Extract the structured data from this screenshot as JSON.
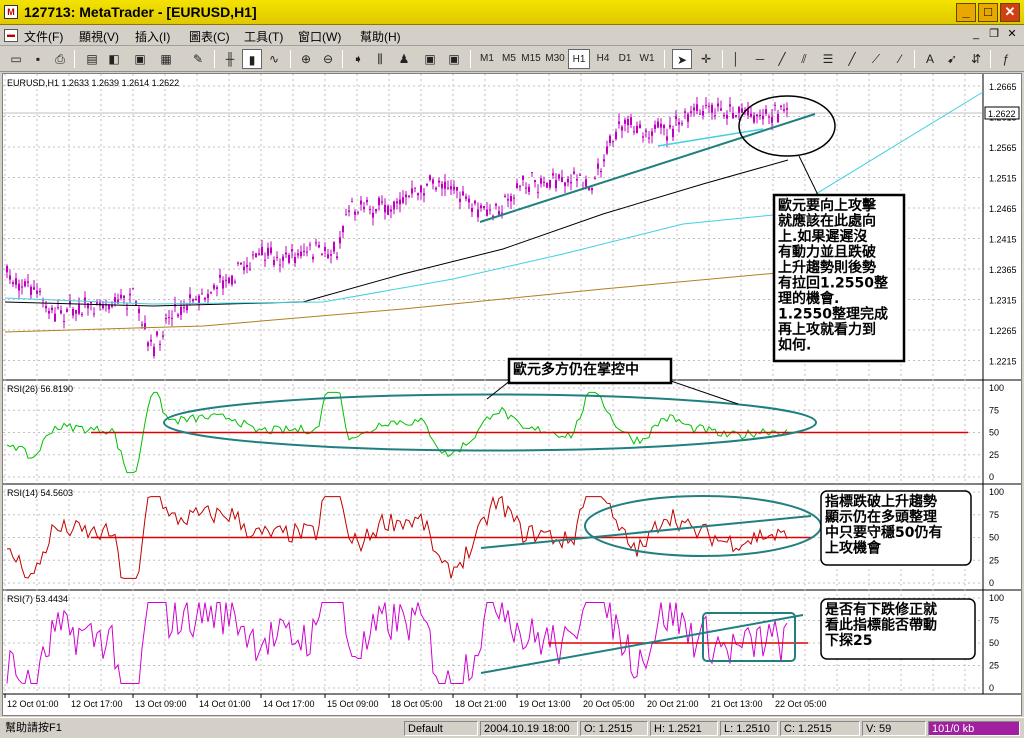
{
  "window": {
    "title": "127713: MetaTrader - [EURUSD,H1]",
    "icon": "metatrader-icon"
  },
  "menu": [
    "文件(F)",
    "顯視(V)",
    "插入(I)",
    "圖表(C)",
    "工具(T)",
    "窗口(W)",
    "幫助(H)"
  ],
  "timeframes": [
    "M1",
    "M5",
    "M15",
    "M30",
    "H1",
    "H4",
    "D1",
    "W1"
  ],
  "active_timeframe": "H1",
  "main_chart": {
    "label": "EURUSD,H1  1.2633  1.2639  1.2614  1.2622",
    "price_ticks": [
      "1.2665",
      "1.2615",
      "1.2565",
      "1.2515",
      "1.2465",
      "1.2415",
      "1.2365",
      "1.2315",
      "1.2265",
      "1.2215"
    ],
    "current_price": "1.2622"
  },
  "rsi_panels": [
    {
      "label": "RSI(26)  56.8190",
      "ticks": [
        "100",
        "75",
        "50",
        "25",
        "0"
      ]
    },
    {
      "label": "RSI(14)  54.5603",
      "ticks": [
        "100",
        "75",
        "50",
        "25",
        "0"
      ]
    },
    {
      "label": "RSI(7)  53.4434",
      "ticks": [
        "100",
        "75",
        "50",
        "25",
        "0"
      ]
    }
  ],
  "x_ticks": [
    "12 Oct 01:00",
    "12 Oct 17:00",
    "13 Oct 09:00",
    "14 Oct 01:00",
    "14 Oct 17:00",
    "15 Oct 09:00",
    "18 Oct 05:00",
    "18 Oct 21:00",
    "19 Oct 13:00",
    "20 Oct 05:00",
    "20 Oct 21:00",
    "21 Oct 13:00",
    "22 Oct 05:00"
  ],
  "annotations": {
    "main_note": [
      "歐元要向上攻擊",
      "就應該在此處向",
      "上.如果遲遲沒",
      "有動力並且跌破",
      "上升趨勢則後勢",
      "有拉回1.2550整",
      "理的機會.",
      "1.2550整理完成",
      "再上攻就看力到",
      "如何."
    ],
    "rsi26_note": "歐元多方仍在掌控中",
    "rsi14_note": [
      "指標跌破上升趨勢",
      "顯示仍在多頭整理",
      "中只要守穩50仍有",
      "上攻機會"
    ],
    "rsi7_note": [
      "是否有下跌修正就",
      "看此指標能否帶動",
      "下探25"
    ]
  },
  "colors": {
    "candles": "#c000c0",
    "rsi26": "#00c000",
    "rsi14": "#c00000",
    "rsi7": "#d000d0",
    "trendline": "#208080",
    "level_line": "#e00000"
  },
  "status": {
    "help": "幫助請按F1",
    "profile": "Default",
    "datetime": "2004.10.19 18:00",
    "open": "O: 1.2515",
    "high": "H: 1.2521",
    "low": "L: 1.2510",
    "close": "C: 1.2515",
    "volume": "V: 59",
    "traffic": "101/0 kb"
  }
}
